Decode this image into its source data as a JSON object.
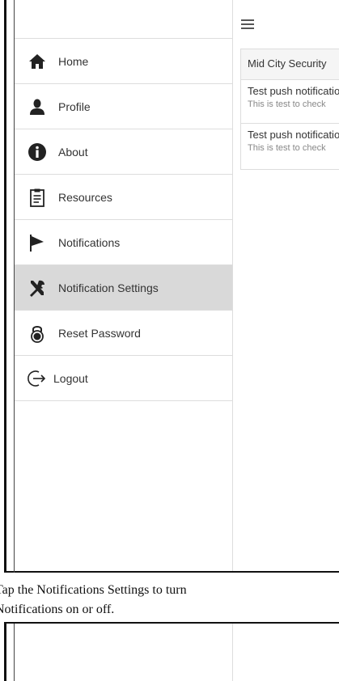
{
  "sidebar": {
    "items": [
      {
        "label": "Home",
        "icon": "home-icon"
      },
      {
        "label": "Profile",
        "icon": "user-icon"
      },
      {
        "label": "About",
        "icon": "info-icon"
      },
      {
        "label": "Resources",
        "icon": "clipboard-icon"
      },
      {
        "label": "Notifications",
        "icon": "flag-icon"
      },
      {
        "label": "Notification Settings",
        "icon": "tools-icon",
        "active": true
      },
      {
        "label": "Reset Password",
        "icon": "lock-icon"
      },
      {
        "label": "Logout",
        "icon": "logout-icon"
      }
    ]
  },
  "main": {
    "header": "Mid City Security",
    "notifications": [
      {
        "title": "Test push notification",
        "subtitle": "This is test to check"
      },
      {
        "title": "Test push notification",
        "subtitle": "This is test to check"
      }
    ]
  },
  "caption": {
    "line1": "Tap the Notifications Settings to turn",
    "line2": "Notifications on or off."
  },
  "colors": {
    "active_bg": "#d9d9d9",
    "border": "#dddddd"
  }
}
